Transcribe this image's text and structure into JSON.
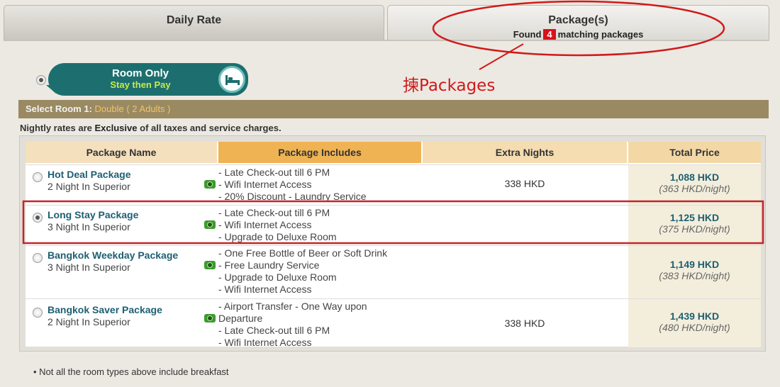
{
  "tabs": {
    "daily": {
      "label": "Daily Rate"
    },
    "packages": {
      "label": "Package(s)",
      "found_prefix": "Found",
      "found_count": "4",
      "found_suffix": "matching packages"
    }
  },
  "annotation": {
    "text": "揀Packages",
    "color": "#d11a1a"
  },
  "room_option": {
    "title": "Room Only",
    "subtitle": "Stay then Pay",
    "icon": "bed-icon",
    "selected": true
  },
  "select_room": {
    "label": "Select Room 1:",
    "value": "Double ( 2 Adults )"
  },
  "notice": {
    "prefix": "Nightly rates are",
    "emphasis": "Exclusive",
    "suffix": "of all taxes and service charges."
  },
  "table": {
    "headers": [
      "Package Name",
      "Package Includes",
      "Extra Nights",
      "Total Price"
    ],
    "rows": [
      {
        "name": "Hot Deal Package",
        "room": "2 Night In Superior",
        "includes": [
          "- Late Check-out till 6 PM",
          "- Wifi Internet Access",
          "- 20% Discount - Laundry Service"
        ],
        "extra": "338 HKD",
        "total": "1,088 HKD",
        "per_night": "(363 HKD/night)",
        "selected": false
      },
      {
        "name": "Long Stay Package",
        "room": "3 Night In Superior",
        "includes": [
          "- Late Check-out till 6 PM",
          "- Wifi Internet Access",
          "- Upgrade to Deluxe Room"
        ],
        "extra": "",
        "total": "1,125 HKD",
        "per_night": "(375 HKD/night)",
        "selected": true
      },
      {
        "name": "Bangkok Weekday Package",
        "room": "3 Night In Superior",
        "includes": [
          "- One Free Bottle of Beer or Soft Drink",
          "- Free Laundry Service",
          "- Upgrade to Deluxe Room",
          "- Wifi Internet Access"
        ],
        "extra": "",
        "total": "1,149 HKD",
        "per_night": "(383 HKD/night)",
        "selected": false
      },
      {
        "name": "Bangkok Saver Package",
        "room": "2 Night In Superior",
        "includes": [
          "- Airport Transfer - One Way upon",
          "Departure",
          "- Late Check-out till 6 PM",
          "- Wifi Internet Access"
        ],
        "extra": "338 HKD",
        "total": "1,439 HKD",
        "per_night": "(480 HKD/night)",
        "selected": false
      }
    ]
  },
  "footnote": "• Not all the room types above include breakfast"
}
